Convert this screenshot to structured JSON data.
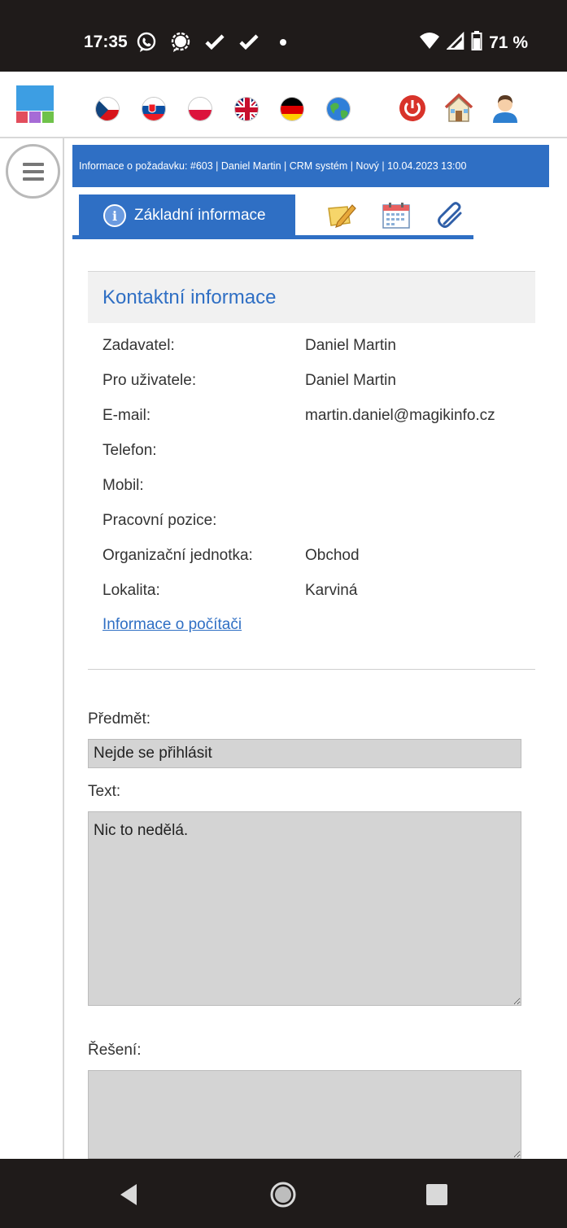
{
  "status_bar": {
    "time": "17:35",
    "battery": "71 %",
    "icons": [
      "viber-icon",
      "signal-app-icon",
      "check-icon",
      "check-icon",
      "dot-icon",
      "wifi-icon",
      "cell-signal-icon",
      "battery-icon"
    ]
  },
  "header": {
    "flags": [
      "cz",
      "sk",
      "pl",
      "gb",
      "de",
      "world"
    ],
    "buttons": [
      "power-icon",
      "home-icon",
      "user-icon"
    ]
  },
  "request_bar": {
    "text": "Informace o požadavku: #603 | Daniel Martin | CRM systém | Nový | 10.04.2023 13:00"
  },
  "tabs": {
    "active_label": "Základní informace",
    "icons": [
      "edit-icon",
      "calendar-icon",
      "attachment-icon"
    ]
  },
  "contact": {
    "title": "Kontaktní informace",
    "rows": [
      {
        "label": "Zadavatel:",
        "value": "Daniel Martin"
      },
      {
        "label": "Pro uživatele:",
        "value": "Daniel Martin"
      },
      {
        "label": "E-mail:",
        "value": "martin.daniel@magikinfo.cz"
      },
      {
        "label": "Telefon:",
        "value": ""
      },
      {
        "label": "Mobil:",
        "value": ""
      },
      {
        "label": "Pracovní pozice:",
        "value": ""
      },
      {
        "label": "Organizační jednotka:",
        "value": "Obchod"
      },
      {
        "label": "Lokalita:",
        "value": "Karviná"
      }
    ],
    "computer_link": "Informace o počítači"
  },
  "form": {
    "subject_label": "Předmět:",
    "subject_value": "Nejde se přihlásit",
    "text_label": "Text:",
    "text_value": "Nic to nedělá.",
    "solution_label": "Řešení:",
    "solution_value": ""
  },
  "colors": {
    "accent": "#2f6fc4",
    "status_bar_bg": "#1f1b1a",
    "field_bg": "#d4d4d4"
  }
}
